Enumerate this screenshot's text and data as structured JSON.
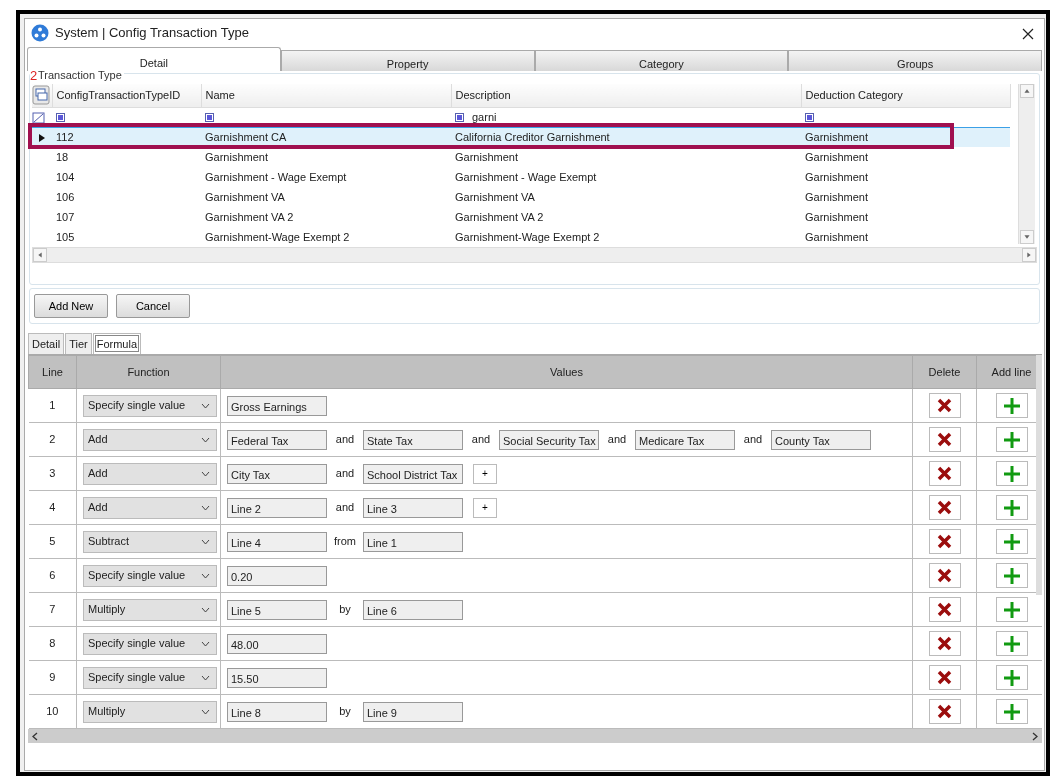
{
  "background_fragment": "2",
  "window": {
    "title": "System | Config Transaction Type"
  },
  "tabs": [
    {
      "label": "Detail",
      "selected": true
    },
    {
      "label": "Property",
      "selected": false
    },
    {
      "label": "Category",
      "selected": false
    },
    {
      "label": "Groups",
      "selected": false
    }
  ],
  "transaction_type": {
    "title": "Transaction Type",
    "columns": [
      {
        "label": "ConfigTransactionTypeID"
      },
      {
        "label": "Name"
      },
      {
        "label": "Description",
        "filter": "garni"
      },
      {
        "label": "Deduction Category"
      }
    ],
    "rows": [
      {
        "selected": true,
        "cells": [
          "112",
          "Garnishment CA",
          "California Creditor Garnishment",
          "Garnishment"
        ]
      },
      {
        "selected": false,
        "cells": [
          "18",
          "Garnishment",
          "Garnishment",
          "Garnishment"
        ]
      },
      {
        "selected": false,
        "cells": [
          "104",
          "Garnishment - Wage Exempt",
          "Garnishment - Wage Exempt",
          "Garnishment"
        ]
      },
      {
        "selected": false,
        "cells": [
          "106",
          "Garnishment VA",
          "Garnishment VA",
          "Garnishment"
        ]
      },
      {
        "selected": false,
        "cells": [
          "107",
          "Garnishment VA 2",
          "Garnishment VA 2",
          "Garnishment"
        ]
      },
      {
        "selected": false,
        "cells": [
          "105",
          "Garnishment-Wage Exempt 2",
          "Garnishment-Wage Exempt 2",
          "Garnishment"
        ]
      }
    ]
  },
  "buttons": [
    "Add New",
    "Cancel"
  ],
  "sub_tabs": [
    {
      "label": "Detail",
      "selected": false
    },
    {
      "label": "Tier",
      "selected": false
    },
    {
      "label": "Formula",
      "selected": true
    }
  ],
  "formula": {
    "columns": [
      "Line",
      "Function",
      "Values",
      "Delete",
      "Add line"
    ],
    "rows": [
      {
        "line": "1",
        "function": "Specify single value",
        "values": [
          {
            "kind": "field",
            "text": "Gross Earnings"
          }
        ]
      },
      {
        "line": "2",
        "function": "Add",
        "values": [
          {
            "kind": "field",
            "text": "Federal Tax"
          },
          {
            "kind": "word",
            "text": "and"
          },
          {
            "kind": "field",
            "text": "State Tax"
          },
          {
            "kind": "word",
            "text": "and"
          },
          {
            "kind": "field",
            "text": "Social Security Tax"
          },
          {
            "kind": "word",
            "text": "and"
          },
          {
            "kind": "field",
            "text": "Medicare Tax"
          },
          {
            "kind": "word",
            "text": "and"
          },
          {
            "kind": "field",
            "text": "County Tax"
          }
        ]
      },
      {
        "line": "3",
        "function": "Add",
        "values": [
          {
            "kind": "field",
            "text": "City Tax"
          },
          {
            "kind": "word",
            "text": "and"
          },
          {
            "kind": "field",
            "text": "School District Tax"
          },
          {
            "kind": "plus",
            "text": "+"
          }
        ]
      },
      {
        "line": "4",
        "function": "Add",
        "values": [
          {
            "kind": "field",
            "text": "Line 2"
          },
          {
            "kind": "word",
            "text": "and"
          },
          {
            "kind": "field",
            "text": "Line 3"
          },
          {
            "kind": "plus",
            "text": "+"
          }
        ]
      },
      {
        "line": "5",
        "function": "Subtract",
        "values": [
          {
            "kind": "field",
            "text": "Line 4"
          },
          {
            "kind": "word",
            "text": "from"
          },
          {
            "kind": "field",
            "text": "Line 1"
          }
        ]
      },
      {
        "line": "6",
        "function": "Specify single value",
        "values": [
          {
            "kind": "field",
            "text": "0.20"
          }
        ]
      },
      {
        "line": "7",
        "function": "Multiply",
        "values": [
          {
            "kind": "field",
            "text": "Line 5"
          },
          {
            "kind": "word",
            "text": "by"
          },
          {
            "kind": "field",
            "text": "Line 6"
          }
        ]
      },
      {
        "line": "8",
        "function": "Specify single value",
        "values": [
          {
            "kind": "field",
            "text": "48.00"
          }
        ]
      },
      {
        "line": "9",
        "function": "Specify single value",
        "values": [
          {
            "kind": "field",
            "text": "15.50"
          }
        ]
      },
      {
        "line": "10",
        "function": "Multiply",
        "values": [
          {
            "kind": "field",
            "text": "Line 8"
          },
          {
            "kind": "word",
            "text": "by"
          },
          {
            "kind": "field",
            "text": "Line 9"
          }
        ]
      }
    ]
  }
}
